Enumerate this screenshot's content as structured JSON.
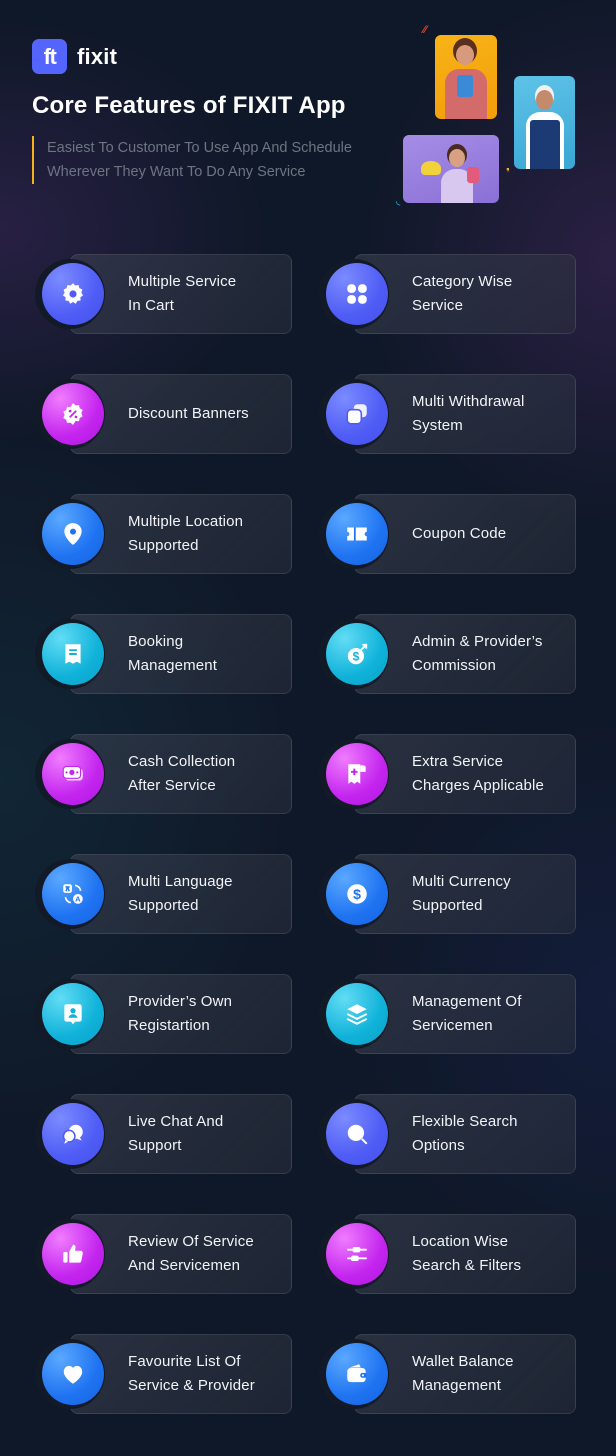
{
  "brand": {
    "logo_text": "ft",
    "name": "fixit",
    "color": "#5465ff"
  },
  "header": {
    "title": "Core Features of FIXIT App",
    "subtitle_line1": "Easiest To Customer To Use App And Schedule",
    "subtitle_line2": "Wherever They Want To Do Any Service",
    "accent_color": "#f6b21b"
  },
  "photos": [
    {
      "name": "woman-with-cleaning-supplies",
      "bg": "#f7b417"
    },
    {
      "name": "serviceman-thumbs-up",
      "bg": "#4fb6e0"
    },
    {
      "name": "woman-with-mop",
      "bg": "#9c85e2"
    }
  ],
  "features": [
    {
      "line1": "Multiple Service",
      "line2": "In Cart",
      "icon": "gear-icon",
      "color": "purple"
    },
    {
      "line1": "Category Wise",
      "line2": "Service",
      "icon": "grid-icon",
      "color": "purple"
    },
    {
      "line1": "Discount Banners",
      "line2": "",
      "icon": "discount-badge-icon",
      "color": "magenta"
    },
    {
      "line1": "Multi Withdrawal",
      "line2": "System",
      "icon": "stacked-squares-icon",
      "color": "purple"
    },
    {
      "line1": "Multiple Location",
      "line2": "Supported",
      "icon": "location-pin-icon",
      "color": "blue"
    },
    {
      "line1": "Coupon Code",
      "line2": "",
      "icon": "ticket-icon",
      "color": "blue"
    },
    {
      "line1": "Booking",
      "line2": "Management",
      "icon": "receipt-icon",
      "color": "cyan"
    },
    {
      "line1": "Admin & Provider’s",
      "line2": "Commission",
      "icon": "money-bag-icon",
      "color": "cyan"
    },
    {
      "line1": "Cash Collection",
      "line2": "After Service",
      "icon": "cash-icon",
      "color": "magenta"
    },
    {
      "line1": "Extra Service",
      "line2": "Charges Applicable",
      "icon": "receipt-plus-icon",
      "color": "magenta"
    },
    {
      "line1": "Multi Language",
      "line2": "Supported",
      "icon": "translate-icon",
      "color": "blue"
    },
    {
      "line1": "Multi Currency",
      "line2": "Supported",
      "icon": "dollar-coin-icon",
      "color": "blue"
    },
    {
      "line1": "Provider’s Own",
      "line2": "Registartion",
      "icon": "user-badge-icon",
      "color": "cyan"
    },
    {
      "line1": "Management Of",
      "line2": "Servicemen",
      "icon": "layers-icon",
      "color": "cyan"
    },
    {
      "line1": "Live Chat And",
      "line2": "Support",
      "icon": "chat-bubbles-icon",
      "color": "purple"
    },
    {
      "line1": "Flexible Search",
      "line2": "Options",
      "icon": "search-icon",
      "color": "purple"
    },
    {
      "line1": "Review Of Service",
      "line2": "And Servicemen",
      "icon": "thumbs-up-icon",
      "color": "magenta"
    },
    {
      "line1": "Location Wise",
      "line2": "Search & Filters",
      "icon": "filter-sliders-icon",
      "color": "magenta"
    },
    {
      "line1": "Favourite List Of",
      "line2": "Service & Provider",
      "icon": "heart-icon",
      "color": "blue"
    },
    {
      "line1": "Wallet Balance",
      "line2": "Management",
      "icon": "wallet-icon",
      "color": "blue"
    }
  ],
  "colors": {
    "purple": "#4f5cf5",
    "magenta": "#c425ee",
    "blue": "#1f73f1",
    "cyan": "#10b2d9",
    "background": "#0f1828"
  }
}
